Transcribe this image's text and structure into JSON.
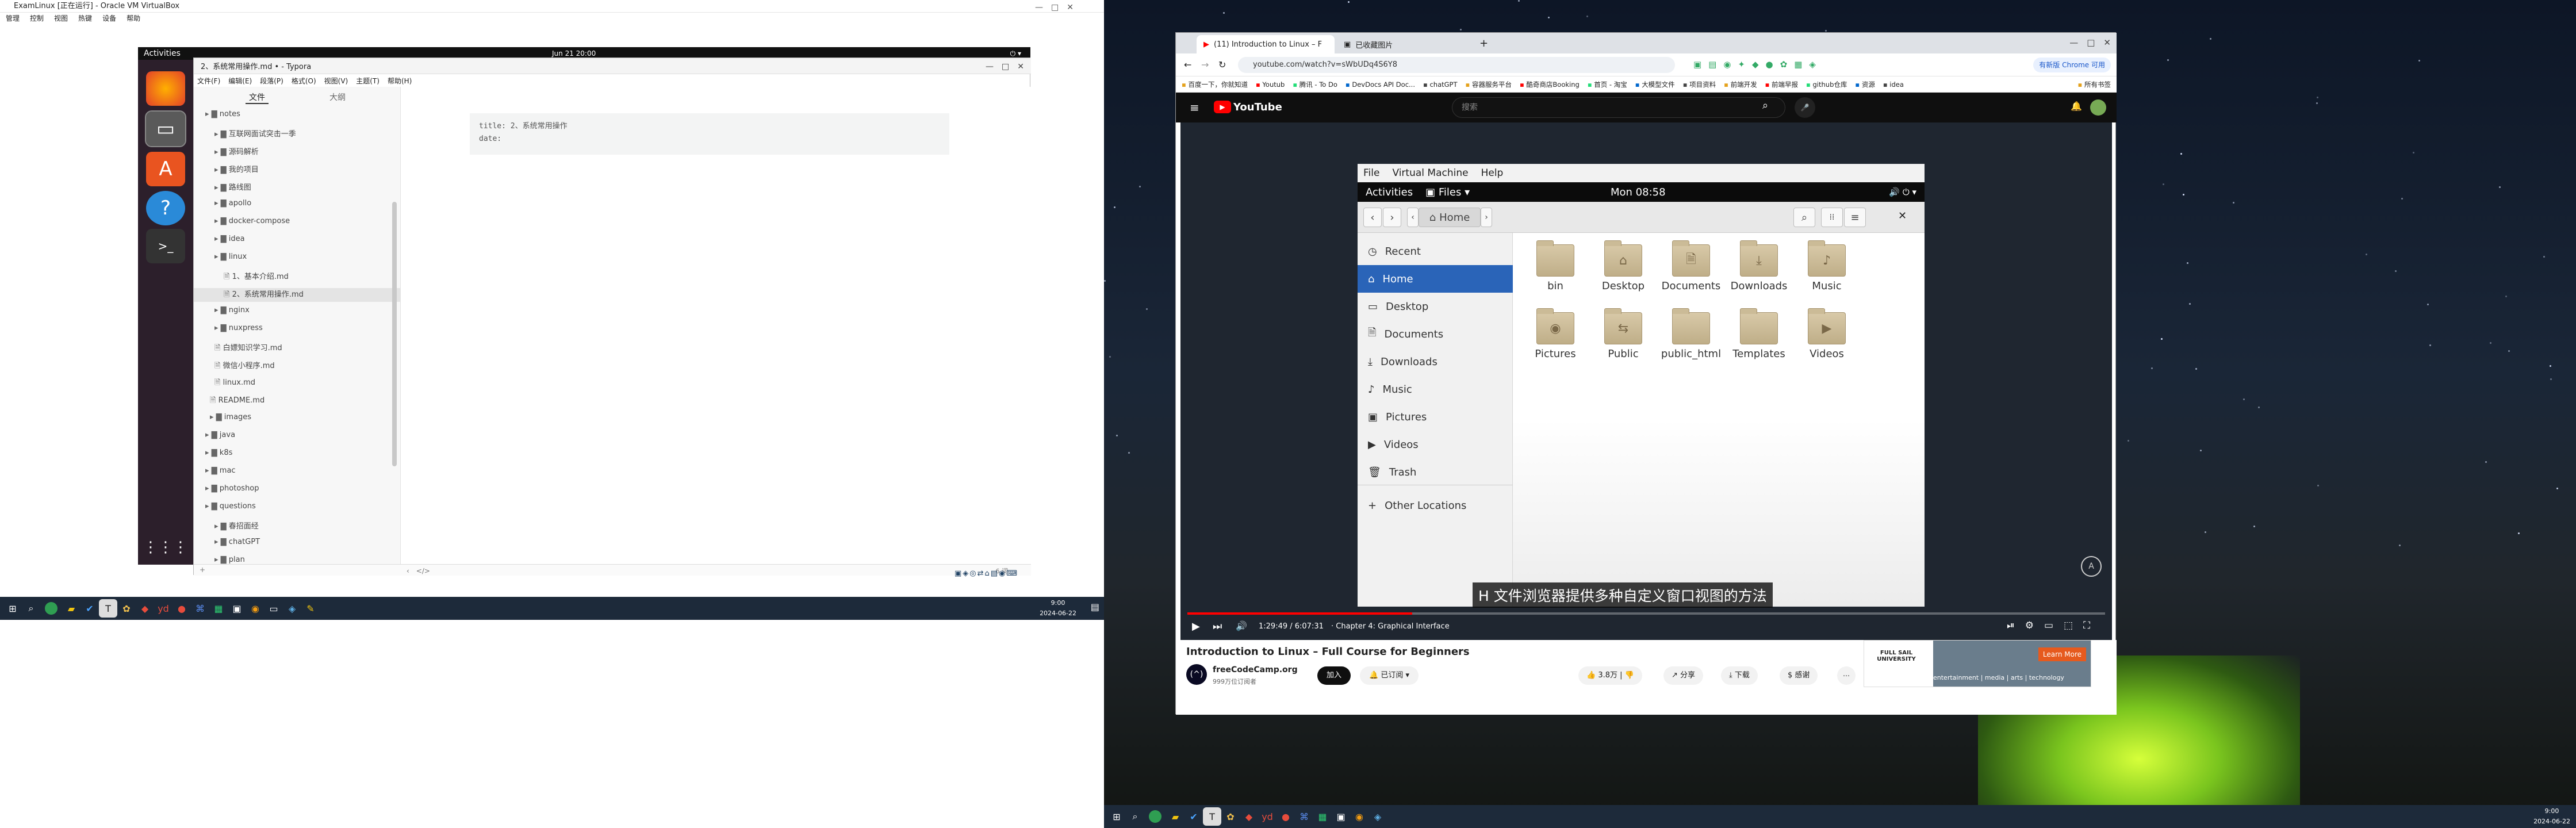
{
  "left": {
    "vbox_title": "ExamLinux [正在运行] - Oracle VM VirtualBox",
    "vbox_menu": [
      "管理",
      "控制",
      "视图",
      "热键",
      "设备",
      "帮助"
    ],
    "vm_activities": "Activities",
    "vm_clock": "Jun 21  20:00",
    "typora_title": "2、系统常用操作.md • - Typora",
    "typora_menu": [
      "文件(F)",
      "编辑(E)",
      "段落(P)",
      "格式(O)",
      "视图(V)",
      "主题(T)",
      "帮助(H)"
    ],
    "side_tabs": [
      "文件",
      "大纲"
    ],
    "tree": [
      "notes",
      "互联网面试突击一季",
      "源码解析",
      "我的项目",
      "路线图",
      "apollo",
      "docker-compose",
      "idea",
      "linux",
      "1、基本介绍.md",
      "2、系统常用操作.md",
      "nginx",
      "nuxpress",
      "白嫖知识学习.md",
      "微信小程序.md",
      "linux.md",
      "README.md",
      "images",
      "java",
      "k8s",
      "mac",
      "photoshop",
      "questions",
      "春招面经",
      "chatGPT",
      "plan"
    ],
    "yaml": [
      "title: 2、系统常用操作",
      "date:"
    ],
    "word_count": "6 词",
    "taskbar_time": "9:00",
    "taskbar_date": "2024-06-22"
  },
  "right": {
    "tabs": [
      "(11) Introduction to Linux – F",
      "已收藏图片"
    ],
    "url": "youtube.com/watch?v=sWbUDq4S6Y8",
    "bookmarks": [
      "百度一下，你就知道",
      "Youtub",
      "腾讯 - To Do",
      "DevDocs API Doc...",
      "chatGPT",
      "容器服务平台",
      "酷奇商店Booking",
      "首页 - 淘宝",
      "大模型文件",
      "项目资料",
      "前端开发",
      "前端早报",
      "github仓库",
      "资源",
      "idea",
      "所有书签"
    ],
    "yt_search_placeholder": "搜索",
    "yt_logo": "YouTube",
    "update_button": "有新版 Chrome 可用",
    "video": {
      "menu": [
        "File",
        "Virtual Machine",
        "Help"
      ],
      "activities": "Activities",
      "files_app": "Files",
      "clock": "Mon 08:58",
      "path_home": "Home",
      "places": [
        "Recent",
        "Home",
        "Desktop",
        "Documents",
        "Downloads",
        "Music",
        "Pictures",
        "Videos",
        "Trash",
        "Other Locations"
      ],
      "folders": [
        "bin",
        "Desktop",
        "Documents",
        "Downloads",
        "Music",
        "Pictures",
        "Public",
        "public_html",
        "Templates",
        "Videos"
      ],
      "subtitle": "H 文件浏览器提供多种自定义窗口视图的方法",
      "time": "1:29:49 / 6:07:31",
      "chapter": "· Chapter 4: Graphical Interface",
      "progress": 0.245
    },
    "video_title": "Introduction to Linux – Full Course for Beginners",
    "channel": "freeCodeCamp.org",
    "subs": "999万位订阅者",
    "join": "加入",
    "subscribed": "已订阅",
    "likes": "3.8万",
    "share": "分享",
    "download": "下载",
    "thanks": "感谢",
    "ad_text": "entertainment | media | arts | technology",
    "ad_button": "Learn More",
    "ad_brand": "FULL SAIL UNIVERSITY",
    "taskbar_time": "9:00",
    "taskbar_date": "2024-06-22"
  },
  "colors": {
    "accent": "#e62117",
    "typora_active": "#e8e8e8",
    "ubuntu_selected": "#2a64b8",
    "taskbar": "#1d2a3a"
  }
}
